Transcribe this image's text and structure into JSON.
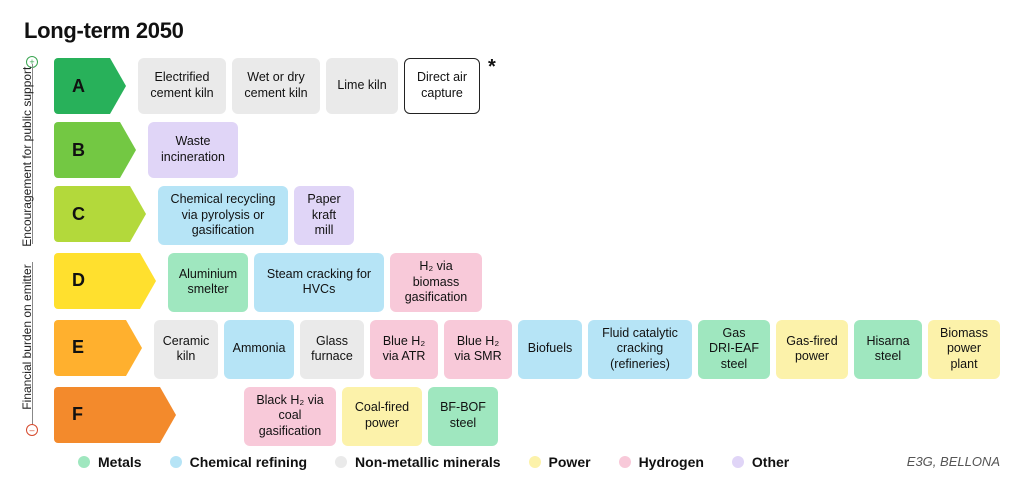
{
  "title": "Long-term 2050",
  "axis": {
    "top_label": "Encouragement for public support",
    "bottom_label": "Financial burden on emitter",
    "top_symbol": "⊕",
    "bottom_symbol": "⊖"
  },
  "categories": {
    "metals": {
      "label": "Metals",
      "color": "#9fe7bf"
    },
    "chemical": {
      "label": "Chemical refining",
      "color": "#b6e4f6"
    },
    "nonmet": {
      "label": "Non-metallic minerals",
      "color": "#eaeaea"
    },
    "power": {
      "label": "Power",
      "color": "#fcf2aa"
    },
    "hydrogen": {
      "label": "Hydrogen",
      "color": "#f8c9d9"
    },
    "other": {
      "label": "Other",
      "color": "#e0d5f7"
    }
  },
  "grades": [
    {
      "id": "A",
      "width": 56,
      "color": "#28b15a",
      "spacer": 0,
      "cells": [
        {
          "label": "Electrified cement kiln",
          "cat": "nonmet",
          "w": 88
        },
        {
          "label": "Wet or dry cement kiln",
          "cat": "nonmet",
          "w": 88
        },
        {
          "label": "Lime kiln",
          "cat": "nonmet",
          "w": 72
        },
        {
          "label": "Direct air capture",
          "cat": "outline",
          "w": 76,
          "outline": true
        },
        {
          "asterisk": true
        }
      ]
    },
    {
      "id": "B",
      "width": 66,
      "color": "#73c843",
      "spacer": 0,
      "cells": [
        {
          "label": "Waste incineration",
          "cat": "other",
          "w": 90
        }
      ]
    },
    {
      "id": "C",
      "width": 76,
      "color": "#b3d93b",
      "spacer": 0,
      "cells": [
        {
          "label": "Chemical recycling via pyrolysis or gasification",
          "cat": "chemical",
          "w": 130
        },
        {
          "label": "Paper kraft mill",
          "cat": "other",
          "w": 60
        }
      ]
    },
    {
      "id": "D",
      "width": 86,
      "color": "#ffe02e",
      "spacer": 0,
      "cells": [
        {
          "label": "Aluminium smelter",
          "cat": "metals",
          "w": 80
        },
        {
          "label": "Steam cracking for HVCs",
          "cat": "chemical",
          "w": 130
        },
        {
          "label": "H₂ via biomass gasification",
          "cat": "hydrogen",
          "w": 92
        }
      ]
    },
    {
      "id": "E",
      "width": 96,
      "color": "#ffb02e",
      "spacer": 0,
      "cells": [
        {
          "label": "Ceramic kiln",
          "cat": "nonmet",
          "w": 64
        },
        {
          "label": "Ammonia",
          "cat": "chemical",
          "w": 70
        },
        {
          "label": "Glass furnace",
          "cat": "nonmet",
          "w": 64
        },
        {
          "label": "Blue H₂ via ATR",
          "cat": "hydrogen",
          "w": 68
        },
        {
          "label": "Blue H₂ via SMR",
          "cat": "hydrogen",
          "w": 68
        },
        {
          "label": "Biofuels",
          "cat": "chemical",
          "w": 64
        },
        {
          "label": "Fluid catalytic cracking (refineries)",
          "cat": "chemical",
          "w": 104
        },
        {
          "label": "Gas DRI-EAF steel",
          "cat": "metals",
          "w": 72
        },
        {
          "label": "Gas-fired power",
          "cat": "power",
          "w": 72
        },
        {
          "label": "Hisarna steel",
          "cat": "metals",
          "w": 68
        },
        {
          "label": "Biomass power plant",
          "cat": "power",
          "w": 72
        }
      ]
    },
    {
      "id": "F",
      "width": 106,
      "color": "#f38a2c",
      "spacer": 50,
      "cells": [
        {
          "label": "Black H₂ via coal gasification",
          "cat": "hydrogen",
          "w": 92
        },
        {
          "label": "Coal-fired power",
          "cat": "power",
          "w": 80
        },
        {
          "label": "BF-BOF steel",
          "cat": "metals",
          "w": 70
        }
      ]
    }
  ],
  "legend_order": [
    "metals",
    "chemical",
    "nonmet",
    "power",
    "hydrogen",
    "other"
  ],
  "credit": "E3G, BELLONA"
}
